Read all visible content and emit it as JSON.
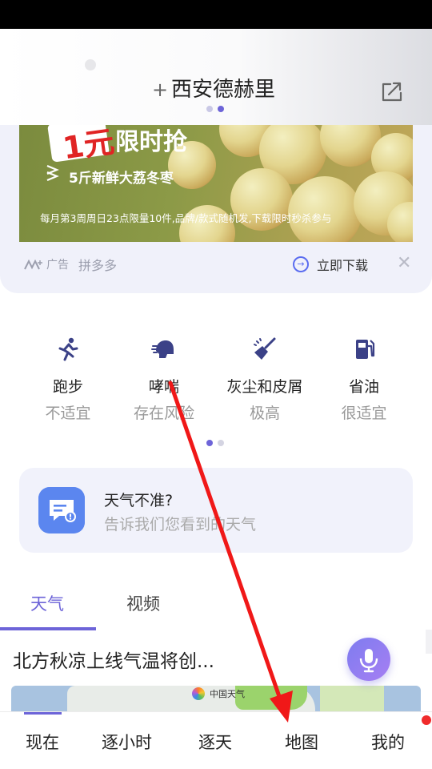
{
  "header": {
    "add_symbol": "+",
    "city": "西安德赫里"
  },
  "ad": {
    "price_tag": "1元",
    "headline": "限时抢",
    "promo": "5斤新鲜大荔冬枣",
    "rules": "每月第3周周日23点限量10件,品牌/款式随机发,下载限时秒杀参与",
    "ad_label": "广告",
    "brand": "拼多多",
    "download_label": "立即下载",
    "close_symbol": "✕"
  },
  "life_index": [
    {
      "name": "跑步",
      "value": "不适宜",
      "icon": "running-icon"
    },
    {
      "name": "哮喘",
      "value": "存在风险",
      "icon": "asthma-icon"
    },
    {
      "name": "灰尘和皮屑",
      "value": "极高",
      "icon": "dust-broom-icon"
    },
    {
      "name": "省油",
      "value": "很适宜",
      "icon": "fuel-pump-icon"
    }
  ],
  "feedback": {
    "title": "天气不准?",
    "subtitle": "告诉我们您看到的天气"
  },
  "content_tabs": {
    "weather": "天气",
    "video": "视频"
  },
  "news": {
    "headline": "北方秋凉上线气温将创...",
    "map_label": "中国天气"
  },
  "bottom_nav": {
    "now": "现在",
    "hourly": "逐小时",
    "daily": "逐天",
    "map": "地图",
    "mine": "我的"
  },
  "colors": {
    "accent": "#6d64d8",
    "annotation_arrow": "#f01818",
    "notification_dot": "#f02b2b"
  }
}
